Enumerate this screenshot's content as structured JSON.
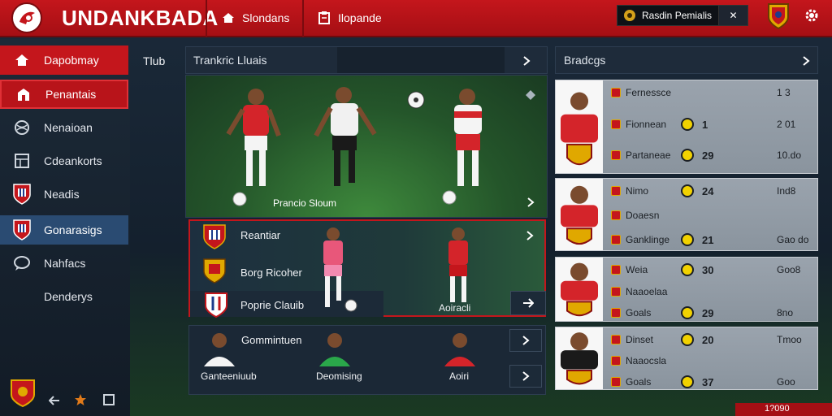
{
  "app": {
    "title": "UNDANKBADA"
  },
  "topnav": {
    "items": [
      {
        "label": "Slondans",
        "icon": "home-icon"
      },
      {
        "label": "Ilopande",
        "icon": "clipboard-icon"
      }
    ],
    "search_label": "Rasdin Pemialis",
    "close_label": "✕"
  },
  "sidebar": {
    "items": [
      {
        "label": "Dapobmay",
        "icon": "home-icon"
      },
      {
        "label": "Penantais",
        "icon": "building-icon"
      },
      {
        "label": "Nenaioan",
        "icon": "globe-icon"
      },
      {
        "label": "Cdeankorts",
        "icon": "grid-icon"
      },
      {
        "label": "Neadis",
        "icon": "crest-icon"
      },
      {
        "label": "Gonarasigs",
        "icon": "crest-icon"
      },
      {
        "label": "Nahfacs",
        "icon": "chat-icon"
      },
      {
        "label": "Denderys",
        "icon": ""
      }
    ]
  },
  "main": {
    "section_label": "Tlub",
    "panel_title": "Trankric Lluais",
    "field_caption": "Prancio Sloum",
    "mid": {
      "rows": [
        {
          "label": "Reantiar"
        },
        {
          "label": "Borg Ricoher"
        },
        {
          "label": "Poprie Clauib"
        }
      ],
      "player_caption": "Aoiracli"
    },
    "low": {
      "title": "Gommintuen",
      "captions": [
        "Ganteeniuub",
        "Deomising",
        "Aoiri"
      ]
    }
  },
  "right": {
    "title": "Bradcgs",
    "cards": [
      {
        "rows": [
          {
            "label": "Fernessce",
            "value": "",
            "extra": "1 3"
          },
          {
            "label": "Fionnean",
            "value": "1",
            "extra": "2 01"
          },
          {
            "label": "Partaneae",
            "value": "29",
            "extra": "10.do"
          }
        ]
      },
      {
        "rows": [
          {
            "label": "Nimo",
            "value": "24",
            "extra": "Ind8"
          },
          {
            "label": "Doaesn",
            "value": "",
            "extra": ""
          },
          {
            "label": "Ganklinge",
            "value": "21",
            "extra": "Gao do"
          }
        ]
      },
      {
        "rows": [
          {
            "label": "Weia",
            "value": "30",
            "extra": "Goo8"
          },
          {
            "label": "Naaoelaa",
            "value": "",
            "extra": ""
          },
          {
            "label": "Goals",
            "value": "29",
            "extra": "8no"
          }
        ]
      },
      {
        "rows": [
          {
            "label": "Dinset",
            "value": "20",
            "extra": "Tmoo"
          },
          {
            "label": "Naaocsla",
            "value": "",
            "extra": ""
          },
          {
            "label": "Goals",
            "value": "37",
            "extra": "Goo"
          }
        ]
      }
    ],
    "bottom_value": "1?090"
  },
  "colors": {
    "brand_red": "#c4161c",
    "accent_blue": "#2a4b72",
    "accent_yellow": "#f2d200"
  }
}
